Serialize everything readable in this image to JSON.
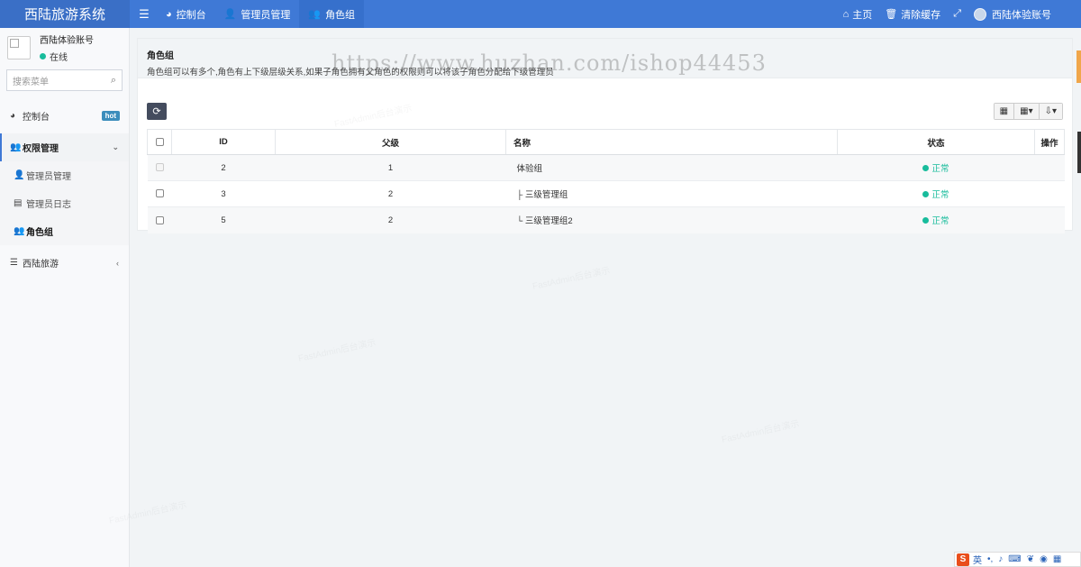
{
  "app": {
    "title": "西陆旅游系统"
  },
  "topnav": {
    "tabs": [
      {
        "label": "控制台",
        "icon": "dashboard-icon"
      },
      {
        "label": "管理员管理",
        "icon": "user-icon"
      },
      {
        "label": "角色组",
        "icon": "users-icon"
      }
    ],
    "right": {
      "home": "主页",
      "clear_cache": "清除缓存",
      "account": "西陆体验账号"
    }
  },
  "sidebar": {
    "user": {
      "name": "西陆体验账号",
      "status": "在线"
    },
    "search_placeholder": "搜索菜单",
    "items": [
      {
        "label": "控制台",
        "badge": "hot"
      },
      {
        "label": "权限管理"
      },
      {
        "label": "管理员管理"
      },
      {
        "label": "管理员日志"
      },
      {
        "label": "角色组"
      },
      {
        "label": "西陆旅游"
      }
    ]
  },
  "page": {
    "title": "角色组",
    "description": "角色组可以有多个,角色有上下级层级关系,如果子角色拥有父角色的权限则可以将该子角色分配给下级管理员"
  },
  "watermark": {
    "url": "https://www.huzhan.com/ishop44453",
    "text": "FastAdmin后台演示"
  },
  "table": {
    "columns": [
      "ID",
      "父级",
      "名称",
      "状态",
      "操作"
    ],
    "rows": [
      {
        "id": "2",
        "pid": "1",
        "name": "体验组",
        "status": "正常"
      },
      {
        "id": "3",
        "pid": "2",
        "name": "├ 三级管理组",
        "status": "正常"
      },
      {
        "id": "5",
        "pid": "2",
        "name": "└ 三级管理组2",
        "status": "正常"
      }
    ]
  },
  "ime": {
    "lang": "英"
  },
  "colors": {
    "primary": "#3f79d6",
    "success": "#18bc9c",
    "hot_badge": "#3c8dbc"
  }
}
